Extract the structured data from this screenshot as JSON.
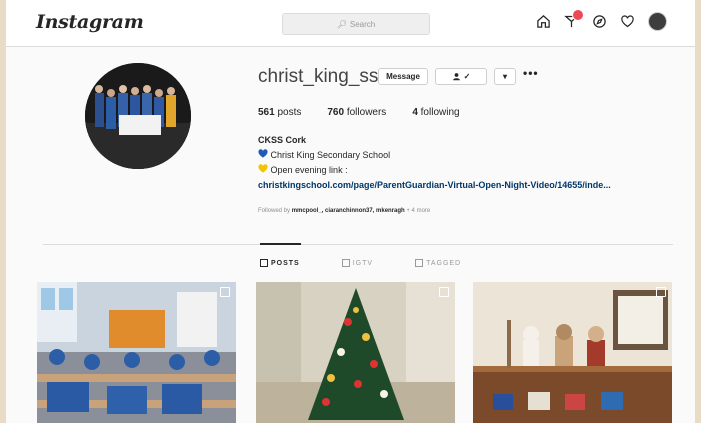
{
  "header": {
    "logo": "Instagram",
    "search_placeholder": "Search",
    "icons": [
      "home-icon",
      "messenger-icon",
      "explore-icon",
      "heart-icon",
      "profile-avatar"
    ]
  },
  "profile": {
    "username": "christ_king_ss",
    "message_label": "Message",
    "follow_label": "✓",
    "dropdown_label": "▾",
    "more_label": "•••",
    "stats": {
      "posts_count": "561",
      "posts_label": "posts",
      "followers_count": "760",
      "followers_label": "followers",
      "following_count": "4",
      "following_label": "following"
    },
    "bio": {
      "name": "CKSS Cork",
      "line1": "Christ King Secondary School",
      "line2": "Open evening link :",
      "link": "christkingschool.com/page/ParentGuardian-Virtual-Open-Night-Video/14655/inde...",
      "followed_by_prefix": "Followed by",
      "followed_by_names": "mmcpool_, ciaranchinnon37, mkenragh",
      "followed_by_more": "+ 4 more"
    }
  },
  "tabs": [
    {
      "label": "POSTS",
      "active": true
    },
    {
      "label": "IGTV",
      "active": false
    },
    {
      "label": "TAGGED",
      "active": false
    }
  ],
  "colors": {
    "accent_link": "#00376b",
    "badge": "#ed4956",
    "heart_blue": "#1e5bb8",
    "heart_yellow": "#f2c500"
  }
}
